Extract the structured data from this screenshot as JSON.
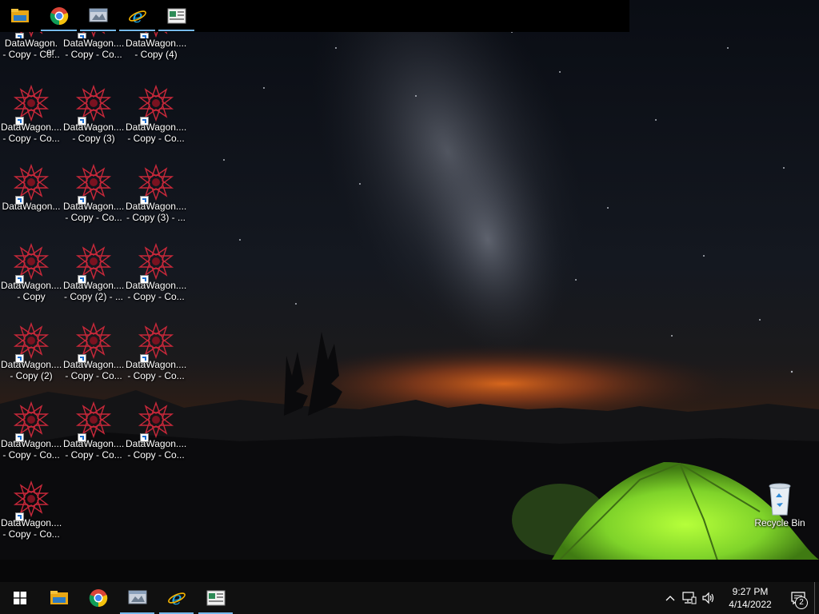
{
  "desktop": {
    "icons": [
      {
        "label1": "DataWagon.",
        "label2": "- Copy - Co..."
      },
      {
        "label1": "DataWagon....",
        "label2": "- Copy - Co..."
      },
      {
        "label1": "DataWagon....",
        "label2": "- Copy (4)"
      },
      {
        "label1": "DataWagon....",
        "label2": "- Copy - Co..."
      },
      {
        "label1": "DataWagon....",
        "label2": "- Copy (3)"
      },
      {
        "label1": "DataWagon....",
        "label2": "- Copy - Co..."
      },
      {
        "label1": "DataWagon...",
        "label2": ""
      },
      {
        "label1": "DataWagon....",
        "label2": "- Copy - Co..."
      },
      {
        "label1": "DataWagon....",
        "label2": "- Copy (3) - ..."
      },
      {
        "label1": "DataWagon....",
        "label2": "- Copy"
      },
      {
        "label1": "DataWagon....",
        "label2": "- Copy (2) - ..."
      },
      {
        "label1": "DataWagon....",
        "label2": "- Copy - Co..."
      },
      {
        "label1": "DataWagon....",
        "label2": "- Copy (2)"
      },
      {
        "label1": "DataWagon....",
        "label2": "- Copy - Co..."
      },
      {
        "label1": "DataWagon....",
        "label2": "- Copy - Co..."
      },
      {
        "label1": "DataWagon....",
        "label2": "- Copy - Co..."
      },
      {
        "label1": "DataWagon....",
        "label2": "- Copy - Co..."
      },
      {
        "label1": "DataWagon....",
        "label2": "- Copy - Co..."
      },
      {
        "label1": "DataWagon....",
        "label2": "- Copy - Co..."
      }
    ],
    "overlap_text": "er",
    "recycle_bin": {
      "label": "Recycle Bin"
    }
  },
  "top_bar": {
    "items": [
      "file-explorer-icon",
      "chrome-icon",
      "app-window-icon",
      "internet-explorer-icon",
      "datawagon-window-icon"
    ]
  },
  "taskbar": {
    "start": "windows-start-icon",
    "apps": [
      "file-explorer-icon",
      "chrome-icon",
      "app-window-icon",
      "internet-explorer-icon",
      "datawagon-window-icon"
    ],
    "clock": {
      "time": "9:27 PM",
      "date": "4/14/2022"
    },
    "notifications": {
      "count": "2"
    }
  },
  "colors": {
    "accent": "#76b9ed",
    "taskbar": "#101010",
    "tent": "#7fd32a",
    "glow": "#d2591a"
  }
}
